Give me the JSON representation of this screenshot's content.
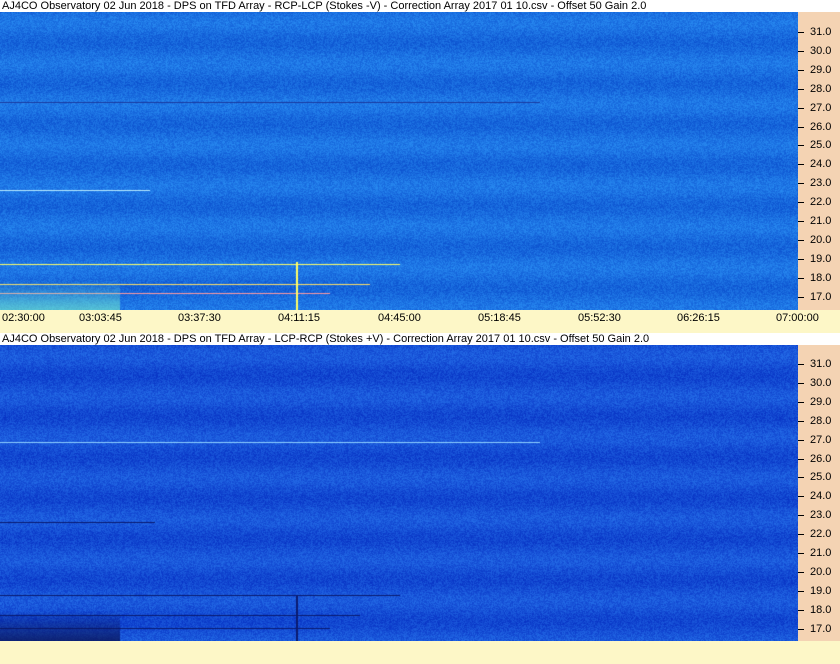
{
  "panels": [
    {
      "title": "AJ4CO Observatory 02 Jun 2018  -  DPS on TFD Array  -  RCP-LCP (Stokes -V)  -  Correction Array 2017 01 10.csv  -  Offset 50  Gain 2.0",
      "base_color": "#1a6ee0",
      "freq_labels": [
        "31.0",
        "30.0",
        "29.0",
        "28.0",
        "27.0",
        "26.0",
        "25.0",
        "24.0",
        "23.0",
        "22.0",
        "21.0",
        "20.0",
        "19.0",
        "18.0",
        "17.0"
      ],
      "time_labels": [
        "02:30:00",
        "03:03:45",
        "03:37:30",
        "04:11:15",
        "04:45:00",
        "05:18:45",
        "05:52:30",
        "06:26:15",
        "07:00:00"
      ]
    },
    {
      "title": "AJ4CO Observatory 02 Jun 2018  -  DPS on TFD Array  -  LCP-RCP (Stokes +V)  -  Correction Array 2017 01 10.csv  -  Offset 50  Gain 2.0",
      "base_color": "#1650d6",
      "freq_labels": [
        "31.0",
        "30.0",
        "29.0",
        "28.0",
        "27.0",
        "26.0",
        "25.0",
        "24.0",
        "23.0",
        "22.0",
        "21.0",
        "20.0",
        "19.0",
        "18.0",
        "17.0"
      ]
    }
  ]
}
